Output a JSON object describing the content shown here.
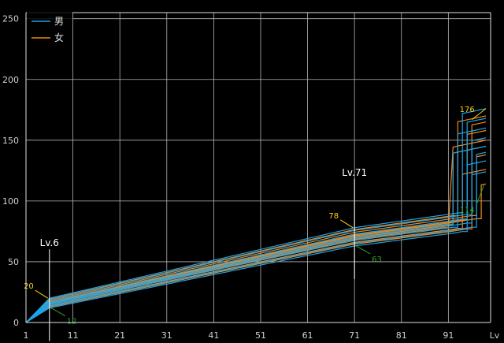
{
  "chart_data": {
    "type": "line",
    "xlabel": "Lv",
    "xlim": [
      1,
      100
    ],
    "ylim": [
      0,
      255
    ],
    "x_ticks": [
      1,
      11,
      21,
      31,
      41,
      51,
      61,
      71,
      81,
      91
    ],
    "y_ticks": [
      0,
      50,
      100,
      150,
      200,
      250
    ],
    "grid": true,
    "legend": {
      "placement": "top-left"
    },
    "series": [
      {
        "name": "男",
        "color": "#1fa3e8"
      },
      {
        "name": "女",
        "color": "#f08a1e"
      }
    ],
    "male_curves": [
      {
        "base": 1.0,
        "jump": 94,
        "end": 176
      },
      {
        "base": 0.0,
        "jump": 95,
        "end": 168
      },
      {
        "base": 0.3,
        "jump": 93,
        "end": 160
      },
      {
        "base": 0.85,
        "jump": 96,
        "end": 152
      },
      {
        "base": 0.5,
        "jump": 92,
        "end": 145
      },
      {
        "base": 0.15,
        "jump": 97,
        "end": 140
      },
      {
        "base": 0.65,
        "jump": 95,
        "end": 133
      },
      {
        "base": 0.4,
        "jump": 96,
        "end": 124
      }
    ],
    "female_curves": [
      {
        "base": 0.9,
        "jump": 93,
        "end": 170
      },
      {
        "base": 0.1,
        "jump": 96,
        "end": 165
      },
      {
        "base": 0.6,
        "jump": 95,
        "end": 158
      },
      {
        "base": 0.35,
        "jump": 91,
        "end": 150
      },
      {
        "base": 0.75,
        "jump": 97,
        "end": 138
      },
      {
        "base": 0.2,
        "jump": 94,
        "end": 126
      },
      {
        "base": 0.55,
        "jump": 98,
        "end": 114
      },
      {
        "base": 0.45,
        "jump": 92,
        "end": 145
      }
    ],
    "markers": [
      {
        "label": "Lv.6",
        "x": 6,
        "max": 20,
        "min": 12
      },
      {
        "label": "Lv.71",
        "x": 71,
        "max": 78,
        "min": 63
      }
    ],
    "end_annotations": {
      "max": 176,
      "min": 114
    }
  },
  "colors": {
    "max_label": "#ffd21a",
    "min_label": "#2aa02a",
    "grid": "#b4b4b4",
    "marker": "#ffffff"
  }
}
